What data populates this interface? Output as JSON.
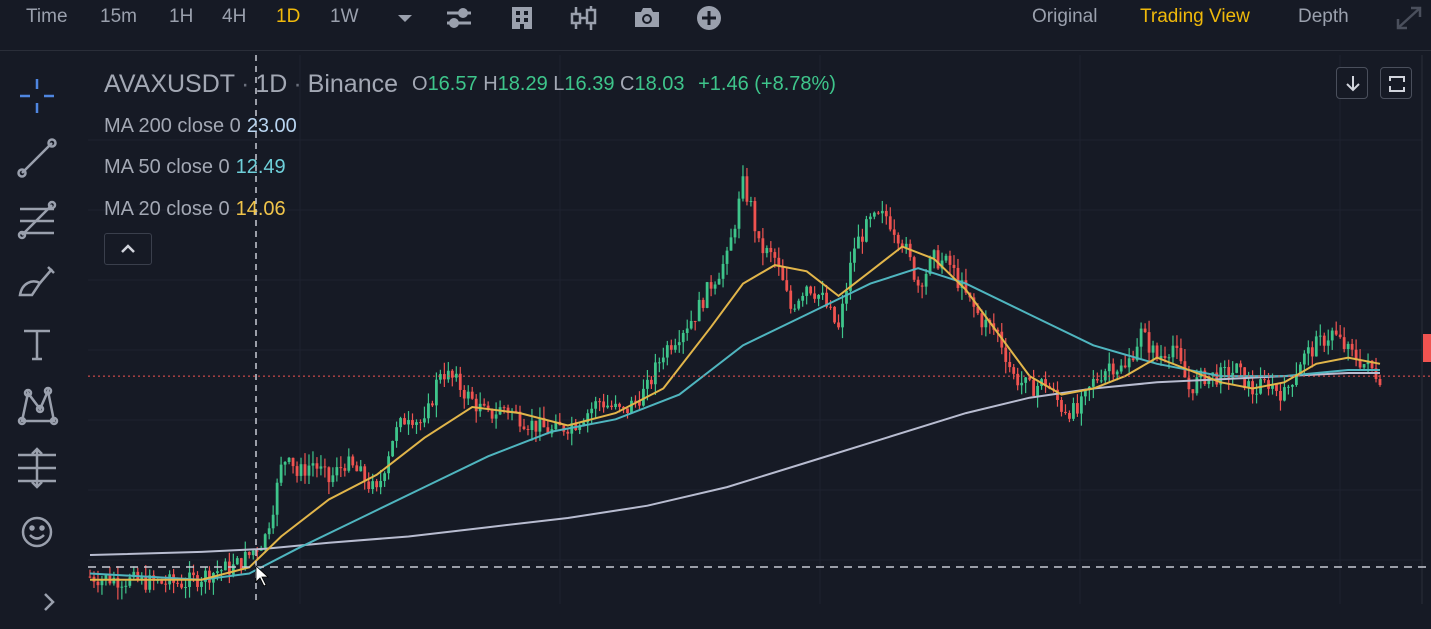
{
  "toolbar": {
    "time_label": "Time",
    "intervals": [
      "15m",
      "1H",
      "4H",
      "1D",
      "1W"
    ],
    "active_interval": "1D",
    "views": [
      "Original",
      "Trading View",
      "Depth"
    ],
    "active_view": "Trading View",
    "icons": [
      "dropdown-caret-icon",
      "settings-sliders-icon",
      "indicators-building-icon",
      "chart-type-candles-icon",
      "camera-icon",
      "add-plus-icon",
      "fullscreen-expand-icon"
    ]
  },
  "left_tools": [
    "crosshair-icon",
    "trendline-icon",
    "fib-retracement-icon",
    "brush-icon",
    "text-icon",
    "pattern-icon",
    "measure-icon",
    "emoji-icon",
    "ruler-icon"
  ],
  "legend": {
    "symbol": "AVAXUSDT",
    "interval": "1D",
    "exchange": "Binance",
    "o_label": "O",
    "o_value": "16.57",
    "h_label": "H",
    "h_value": "18.29",
    "l_label": "L",
    "l_value": "16.39",
    "c_label": "C",
    "c_value": "18.03",
    "change": "+1.46 (+8.78%)",
    "ma200_label": "MA 200 close 0",
    "ma200_value": "23.00",
    "ma50_label": "MA 50 close 0",
    "ma50_value": "12.49",
    "ma20_label": "MA 20 close 0",
    "ma20_value": "14.06"
  },
  "colors": {
    "up": "#3ec58b",
    "down": "#ef5350",
    "ma200": "#b8bcd0",
    "ma50": "#4fb5bf",
    "ma20": "#e1b54a",
    "accent": "#f0b90b",
    "background": "#161a25"
  },
  "chart_data": {
    "type": "candlestick",
    "symbol": "AVAXUSDT",
    "interval": "1D",
    "last_close": 18.03,
    "y_range": [
      0,
      155
    ],
    "series": [
      {
        "name": "MA 200 close 0",
        "last": 23.0
      },
      {
        "name": "MA 50 close 0",
        "last": 12.49
      },
      {
        "name": "MA 20 close 0",
        "last": 14.06
      }
    ],
    "close_path": [
      [
        0,
        5
      ],
      [
        4,
        4
      ],
      [
        8,
        3
      ],
      [
        12,
        3
      ],
      [
        14,
        5
      ],
      [
        16,
        7
      ],
      [
        18,
        8
      ],
      [
        20,
        12
      ],
      [
        22,
        18
      ],
      [
        23,
        28
      ],
      [
        24,
        40
      ],
      [
        25,
        46
      ],
      [
        26,
        38
      ],
      [
        28,
        42
      ],
      [
        30,
        36
      ],
      [
        32,
        42
      ],
      [
        34,
        38
      ],
      [
        36,
        32
      ],
      [
        38,
        50
      ],
      [
        40,
        58
      ],
      [
        42,
        54
      ],
      [
        44,
        72
      ],
      [
        46,
        68
      ],
      [
        48,
        62
      ],
      [
        50,
        57
      ],
      [
        52,
        60
      ],
      [
        55,
        55
      ],
      [
        58,
        52
      ],
      [
        61,
        55
      ],
      [
        64,
        62
      ],
      [
        67,
        58
      ],
      [
        70,
        66
      ],
      [
        72,
        78
      ],
      [
        74,
        84
      ],
      [
        76,
        90
      ],
      [
        78,
        100
      ],
      [
        80,
        108
      ],
      [
        82,
        132
      ],
      [
        83,
        125
      ],
      [
        84,
        112
      ],
      [
        86,
        108
      ],
      [
        88,
        92
      ],
      [
        90,
        100
      ],
      [
        92,
        95
      ],
      [
        94,
        85
      ],
      [
        96,
        112
      ],
      [
        98,
        120
      ],
      [
        100,
        122
      ],
      [
        102,
        114
      ],
      [
        104,
        100
      ],
      [
        106,
        108
      ],
      [
        108,
        106
      ],
      [
        110,
        96
      ],
      [
        112,
        88
      ],
      [
        114,
        84
      ],
      [
        116,
        70
      ],
      [
        118,
        66
      ],
      [
        120,
        68
      ],
      [
        122,
        60
      ],
      [
        124,
        58
      ],
      [
        126,
        68
      ],
      [
        128,
        74
      ],
      [
        130,
        72
      ],
      [
        132,
        84
      ],
      [
        134,
        76
      ],
      [
        136,
        80
      ],
      [
        138,
        66
      ],
      [
        140,
        70
      ],
      [
        142,
        70
      ],
      [
        144,
        72
      ],
      [
        146,
        65
      ],
      [
        148,
        68
      ],
      [
        150,
        64
      ],
      [
        152,
        75
      ],
      [
        154,
        80
      ],
      [
        156,
        84
      ],
      [
        158,
        78
      ],
      [
        160,
        74
      ],
      [
        162,
        70
      ]
    ],
    "ma20_path": [
      [
        0,
        4
      ],
      [
        14,
        4
      ],
      [
        20,
        8
      ],
      [
        24,
        18
      ],
      [
        30,
        30
      ],
      [
        36,
        38
      ],
      [
        42,
        50
      ],
      [
        48,
        60
      ],
      [
        54,
        58
      ],
      [
        60,
        54
      ],
      [
        66,
        58
      ],
      [
        72,
        66
      ],
      [
        78,
        86
      ],
      [
        82,
        100
      ],
      [
        86,
        106
      ],
      [
        90,
        104
      ],
      [
        94,
        96
      ],
      [
        98,
        104
      ],
      [
        102,
        112
      ],
      [
        106,
        108
      ],
      [
        110,
        98
      ],
      [
        114,
        84
      ],
      [
        118,
        70
      ],
      [
        122,
        64
      ],
      [
        126,
        66
      ],
      [
        130,
        70
      ],
      [
        134,
        76
      ],
      [
        138,
        72
      ],
      [
        142,
        68
      ],
      [
        146,
        66
      ],
      [
        150,
        68
      ],
      [
        154,
        74
      ],
      [
        158,
        76
      ],
      [
        162,
        74
      ]
    ],
    "ma50_path": [
      [
        0,
        6
      ],
      [
        14,
        4
      ],
      [
        20,
        6
      ],
      [
        26,
        14
      ],
      [
        34,
        24
      ],
      [
        42,
        34
      ],
      [
        50,
        44
      ],
      [
        58,
        52
      ],
      [
        66,
        56
      ],
      [
        74,
        64
      ],
      [
        82,
        80
      ],
      [
        90,
        90
      ],
      [
        98,
        100
      ],
      [
        104,
        105
      ],
      [
        110,
        100
      ],
      [
        118,
        90
      ],
      [
        126,
        80
      ],
      [
        134,
        74
      ],
      [
        142,
        70
      ],
      [
        150,
        70
      ],
      [
        158,
        72
      ],
      [
        162,
        72
      ]
    ],
    "ma200_path": [
      [
        0,
        12
      ],
      [
        14,
        13
      ],
      [
        22,
        14
      ],
      [
        30,
        16
      ],
      [
        40,
        18
      ],
      [
        50,
        21
      ],
      [
        60,
        24
      ],
      [
        70,
        28
      ],
      [
        80,
        34
      ],
      [
        90,
        42
      ],
      [
        100,
        50
      ],
      [
        110,
        58
      ],
      [
        118,
        63
      ],
      [
        126,
        66
      ],
      [
        134,
        68
      ],
      [
        142,
        69
      ],
      [
        150,
        70
      ],
      [
        158,
        71
      ],
      [
        162,
        71
      ]
    ]
  }
}
